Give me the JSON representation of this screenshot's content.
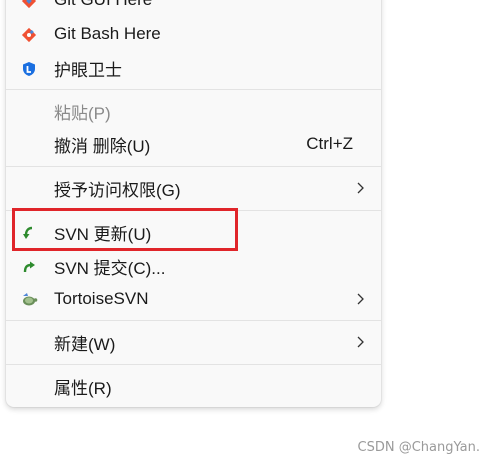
{
  "menu": {
    "items": [
      {
        "label": "Git GUI Here",
        "icon": "git-gui-icon"
      },
      {
        "label": "Git Bash Here",
        "icon": "git-bash-icon"
      },
      {
        "label": "护眼卫士",
        "icon": "eye-guard-icon"
      },
      {
        "label": "粘贴(P)",
        "disabled": true
      },
      {
        "label": "撤消 删除(U)",
        "shortcut": "Ctrl+Z"
      },
      {
        "label": "授予访问权限(G)",
        "submenu": true
      },
      {
        "label": "SVN 更新(U)",
        "icon": "svn-update-icon"
      },
      {
        "label": "SVN 提交(C)...",
        "icon": "svn-commit-icon"
      },
      {
        "label": "TortoiseSVN",
        "icon": "tortoisesvn-icon",
        "submenu": true
      },
      {
        "label": "新建(W)",
        "submenu": true
      },
      {
        "label": "属性(R)"
      }
    ]
  },
  "colors": {
    "highlight_border": "#e0252a",
    "menu_background": "#f9f9f9",
    "separator": "#e3e3e3",
    "disabled_text": "#8a8a8a"
  },
  "watermark": "CSDN @ChangYan."
}
